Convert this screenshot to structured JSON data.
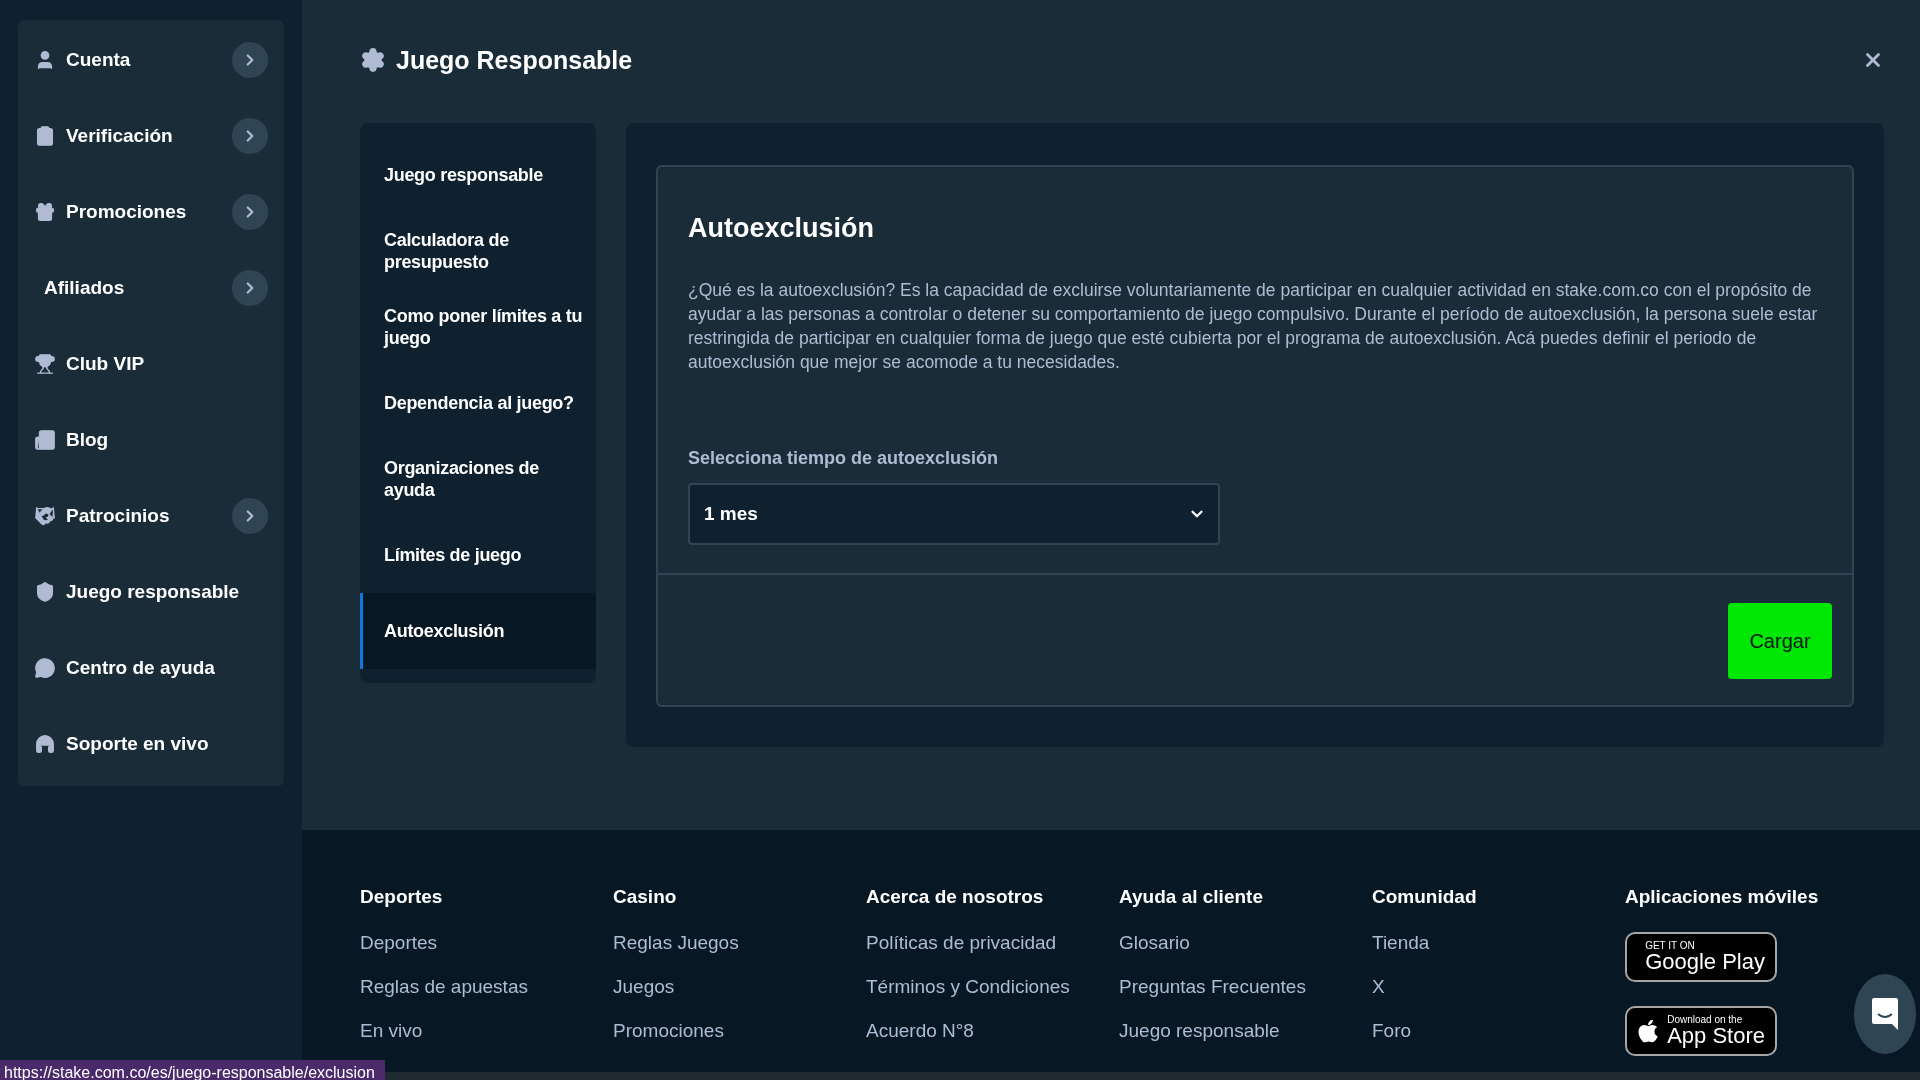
{
  "sidebar": {
    "items": [
      {
        "label": "Cuenta",
        "expandable": true
      },
      {
        "label": "Verificación",
        "expandable": true
      },
      {
        "label": "Promociones",
        "expandable": true
      },
      {
        "label": "Afiliados",
        "expandable": true
      },
      {
        "label": "Club VIP",
        "expandable": false
      },
      {
        "label": "Blog",
        "expandable": false
      },
      {
        "label": "Patrocinios",
        "expandable": true
      },
      {
        "label": "Juego responsable",
        "expandable": false
      },
      {
        "label": "Centro de ayuda",
        "expandable": false
      },
      {
        "label": "Soporte en vivo",
        "expandable": false
      }
    ]
  },
  "modal": {
    "title": "Juego Responsable",
    "nav": [
      {
        "label": "Juego responsable",
        "selected": false
      },
      {
        "label": "Calculadora de presupuesto",
        "selected": false
      },
      {
        "label": "Como poner límites a tu juego",
        "selected": false
      },
      {
        "label": "Dependencia al juego?",
        "selected": false
      },
      {
        "label": "Organizaciones de ayuda",
        "selected": false
      },
      {
        "label": "Límites de juego",
        "selected": false
      },
      {
        "label": "Autoexclusión",
        "selected": true
      }
    ],
    "section": {
      "heading": "Autoexclusión",
      "description": "¿Qué es la autoexclusión? Es la capacidad de excluirse voluntariamente de participar en cualquier actividad en stake.com.co con el propósito de ayudar a las personas a controlar o detener su comportamiento de juego compulsivo. Durante el período de autoexclusión, la persona suele estar restringida de participar en cualquier forma de juego que esté cubierta por el programa de autoexclusión. Acá puedes definir el periodo de autoexclusión que mejor se acomode a tu necesidades.",
      "select_label": "Selecciona tiempo de autoexclusión",
      "select_value": "1 mes",
      "button": "Cargar"
    }
  },
  "footer": {
    "columns": [
      {
        "heading": "Deportes",
        "links": [
          "Deportes",
          "Reglas de apuestas",
          "En vivo"
        ]
      },
      {
        "heading": "Casino",
        "links": [
          "Reglas Juegos",
          "Juegos",
          "Promociones"
        ]
      },
      {
        "heading": "Acerca de nosotros",
        "links": [
          "Políticas de privacidad",
          "Términos y Condiciones",
          "Acuerdo N°8"
        ]
      },
      {
        "heading": "Ayuda al cliente",
        "links": [
          "Glosario",
          "Preguntas Frecuentes",
          "Juego responsable"
        ]
      },
      {
        "heading": "Comunidad",
        "links": [
          "Tienda",
          "X",
          "Foro"
        ]
      }
    ],
    "apps": {
      "heading": "Aplicaciones móviles",
      "google": {
        "small": "GET IT ON",
        "big": "Google Play"
      },
      "apple": {
        "small": "Download on the",
        "big": "App Store"
      }
    }
  },
  "status_bar": {
    "url": "https://stake.com.co/es/juego-responsable/exclusion"
  }
}
